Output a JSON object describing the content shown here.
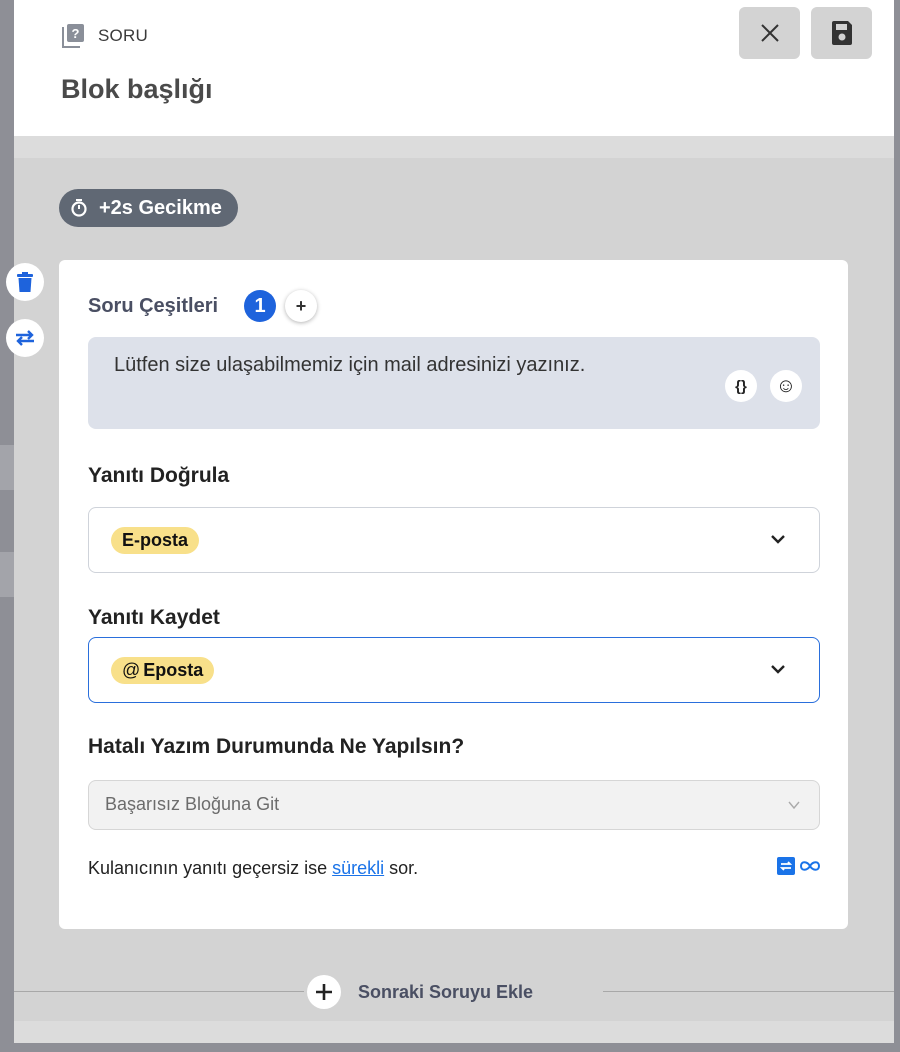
{
  "header": {
    "type_label": "SORU",
    "title": "Blok başlığı"
  },
  "delay": {
    "label": "+2s Gecikme"
  },
  "card": {
    "question_types": {
      "label": "Soru Çeşitleri",
      "count": "1",
      "add": "+"
    },
    "message": {
      "text": "Lütfen size ulaşabilmemiz için mail adresinizi yazınız.",
      "var_button": "{}",
      "emoji_button": "☺"
    },
    "validate": {
      "label": "Yanıtı Doğrula",
      "value": "E-posta"
    },
    "save": {
      "label": "Yanıtı Kaydet",
      "value_prefix": "@",
      "value": "Eposta"
    },
    "on_error": {
      "label": "Hatalı Yazım Durumunda Ne Yapılsın?",
      "value": "Başarısız Bloğuna Git"
    },
    "footnote": {
      "before": "Kulanıcının yanıtı geçersiz ise ",
      "link": "sürekli",
      "after": " sor."
    }
  },
  "footer": {
    "add_next": "Sonraki Soruyu Ekle"
  },
  "colors": {
    "primary": "#1e63dc",
    "chip": "#f8e08a",
    "delay_badge": "#606874"
  }
}
